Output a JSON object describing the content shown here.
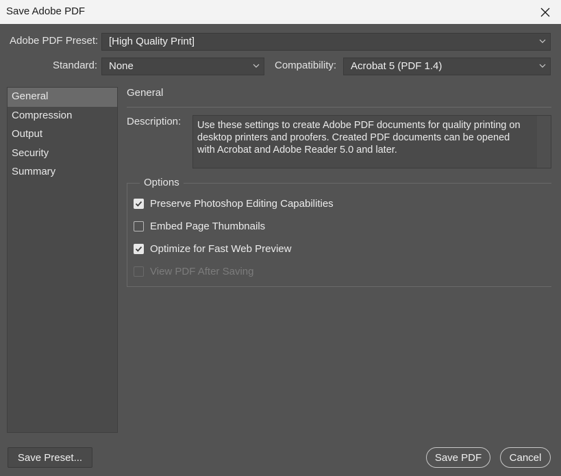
{
  "window": {
    "title": "Save Adobe PDF"
  },
  "preset": {
    "label": "Adobe PDF Preset:",
    "value": "[High Quality Print]"
  },
  "standard": {
    "label": "Standard:",
    "value": "None"
  },
  "compatibility": {
    "label": "Compatibility:",
    "value": "Acrobat 5 (PDF 1.4)"
  },
  "sidebar": {
    "items": [
      {
        "label": "General",
        "active": true
      },
      {
        "label": "Compression"
      },
      {
        "label": "Output"
      },
      {
        "label": "Security"
      },
      {
        "label": "Summary"
      }
    ]
  },
  "general": {
    "title": "General",
    "description_label": "Description:",
    "description_lines": [
      "Use these settings to create Adobe PDF documents for quality printing on",
      "desktop printers and proofers.  Created PDF documents can be opened",
      "with Acrobat and Adobe Reader 5.0 and later."
    ],
    "options_label": "Options",
    "options": [
      {
        "label": "Preserve Photoshop Editing Capabilities",
        "checked": true,
        "enabled": true
      },
      {
        "label": "Embed Page Thumbnails",
        "checked": false,
        "enabled": true
      },
      {
        "label": "Optimize for Fast Web Preview",
        "checked": true,
        "enabled": true
      },
      {
        "label": "View PDF After Saving",
        "checked": false,
        "enabled": false
      }
    ]
  },
  "buttons": {
    "save_preset": "Save Preset...",
    "save_pdf": "Save PDF",
    "cancel": "Cancel"
  },
  "colors": {
    "background": "#535353",
    "titlebar": "#f3f3f3",
    "field": "#454545",
    "selected_item": "#6a6a6a"
  }
}
